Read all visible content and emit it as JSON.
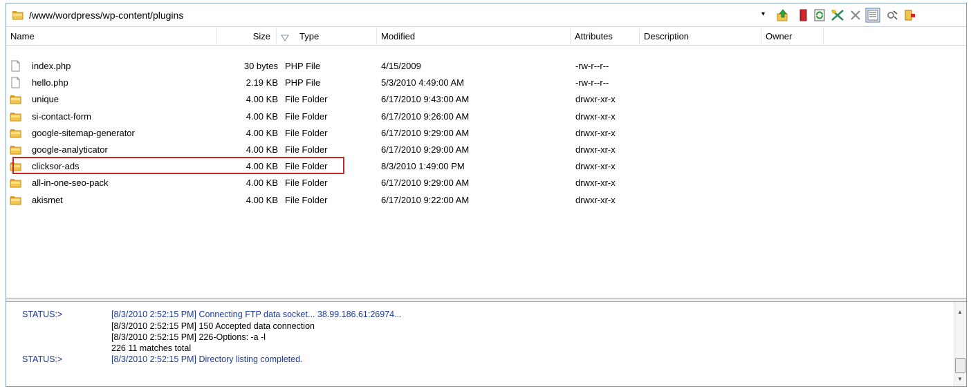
{
  "path": {
    "text": "/www/wordpress/wp-content/plugins",
    "dropdown_glyph": "▾"
  },
  "toolbar": {
    "icons": [
      "up-folder-icon",
      "bookmark-icon",
      "refresh-icon",
      "cancel-transfer-icon",
      "delete-icon",
      "list-view-icon",
      "settings-icon",
      "exit-icon"
    ]
  },
  "columns": {
    "name": "Name",
    "size": "Size",
    "type": "Type",
    "modified": "Modified",
    "attributes": "Attributes",
    "description": "Description",
    "owner": "Owner"
  },
  "files": [
    {
      "icon": "file-icon",
      "name": "index.php",
      "size": "30 bytes",
      "type": "PHP File",
      "modified": "4/15/2009",
      "attributes": "-rw-r--r--"
    },
    {
      "icon": "file-icon",
      "name": "hello.php",
      "size": "2.19 KB",
      "type": "PHP File",
      "modified": "5/3/2010 4:49:00 AM",
      "attributes": "-rw-r--r--"
    },
    {
      "icon": "folder-icon",
      "name": "unique",
      "size": "4.00 KB",
      "type": "File Folder",
      "modified": "6/17/2010 9:43:00 AM",
      "attributes": "drwxr-xr-x"
    },
    {
      "icon": "folder-icon",
      "name": "si-contact-form",
      "size": "4.00 KB",
      "type": "File Folder",
      "modified": "6/17/2010 9:26:00 AM",
      "attributes": "drwxr-xr-x"
    },
    {
      "icon": "folder-icon",
      "name": "google-sitemap-generator",
      "size": "4.00 KB",
      "type": "File Folder",
      "modified": "6/17/2010 9:29:00 AM",
      "attributes": "drwxr-xr-x"
    },
    {
      "icon": "folder-icon",
      "name": "google-analyticator",
      "size": "4.00 KB",
      "type": "File Folder",
      "modified": "6/17/2010 9:29:00 AM",
      "attributes": "drwxr-xr-x"
    },
    {
      "icon": "folder-icon",
      "name": "clicksor-ads",
      "size": "4.00 KB",
      "type": "File Folder",
      "modified": "8/3/2010 1:49:00 PM",
      "attributes": "drwxr-xr-x"
    },
    {
      "icon": "folder-icon",
      "name": "all-in-one-seo-pack",
      "size": "4.00 KB",
      "type": "File Folder",
      "modified": "6/17/2010 9:29:00 AM",
      "attributes": "drwxr-xr-x"
    },
    {
      "icon": "folder-icon",
      "name": "akismet",
      "size": "4.00 KB",
      "type": "File Folder",
      "modified": "6/17/2010 9:22:00 AM",
      "attributes": "drwxr-xr-x"
    }
  ],
  "log": {
    "status1": "STATUS:>",
    "msg1": "[8/3/2010 2:52:15 PM] Connecting FTP data socket... 38.99.186.61:26974...",
    "msg2": "[8/3/2010 2:52:15 PM] 150 Accepted data connection",
    "msg3": "[8/3/2010 2:52:15 PM] 226-Options: -a -l",
    "msg4": "226 11 matches total",
    "status2": "STATUS:>",
    "msg5": "[8/3/2010 2:52:15 PM] Directory listing completed."
  },
  "colors": {
    "highlight_border": "#c0262b",
    "log_text": "#1c3a9c"
  }
}
